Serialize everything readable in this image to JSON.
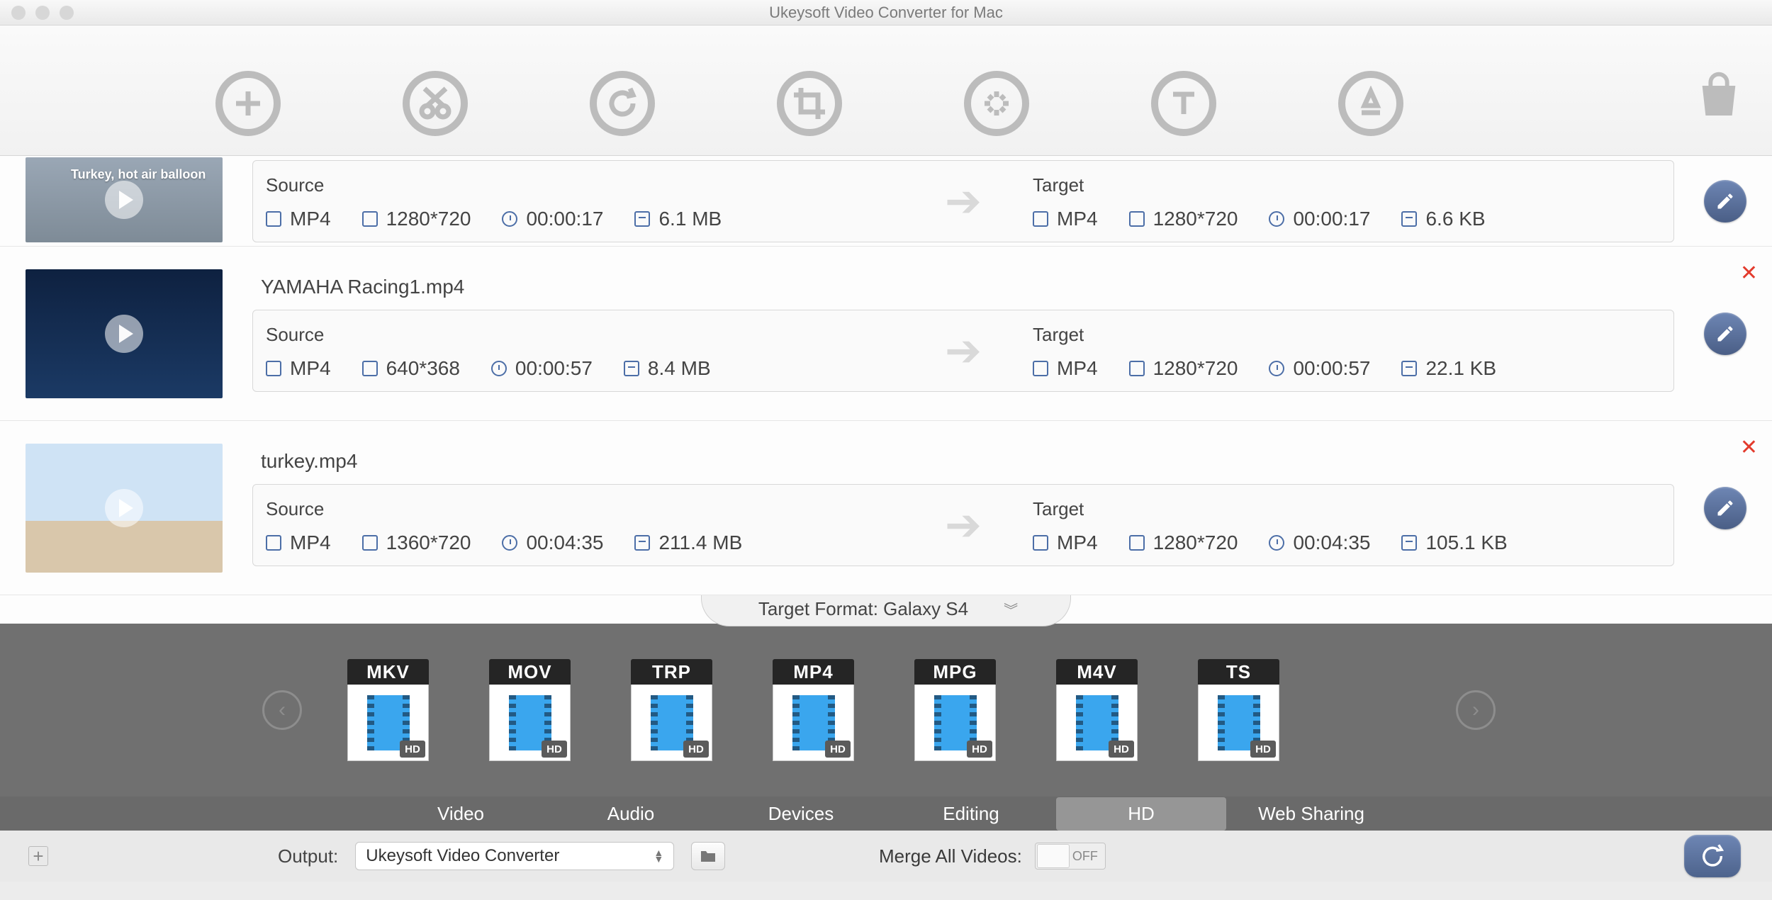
{
  "window": {
    "title": "Ukeysoft Video Converter for Mac"
  },
  "toolbar": {
    "icons": [
      "add",
      "trim",
      "rotate",
      "crop",
      "effects",
      "text",
      "watermark"
    ],
    "store_icon": "shopping-bag"
  },
  "labels": {
    "source": "Source",
    "target": "Target"
  },
  "items": [
    {
      "file": "",
      "thumb_caption": "Turkey, hot air balloon",
      "source": {
        "format": "MP4",
        "resolution": "1280*720",
        "duration": "00:00:17",
        "size": "6.1 MB"
      },
      "target": {
        "format": "MP4",
        "resolution": "1280*720",
        "duration": "00:00:17",
        "size": "6.6 KB"
      }
    },
    {
      "file": "YAMAHA Racing1.mp4",
      "thumb_caption": "",
      "source": {
        "format": "MP4",
        "resolution": "640*368",
        "duration": "00:00:57",
        "size": "8.4 MB"
      },
      "target": {
        "format": "MP4",
        "resolution": "1280*720",
        "duration": "00:00:57",
        "size": "22.1 KB"
      }
    },
    {
      "file": "turkey.mp4",
      "thumb_caption": "",
      "source": {
        "format": "MP4",
        "resolution": "1360*720",
        "duration": "00:04:35",
        "size": "211.4 MB"
      },
      "target": {
        "format": "MP4",
        "resolution": "1280*720",
        "duration": "00:04:35",
        "size": "105.1 KB"
      }
    }
  ],
  "target_format": {
    "label_prefix": "Target Format: ",
    "value": "Galaxy S4"
  },
  "formats": [
    "MKV",
    "MOV",
    "TRP",
    "MP4",
    "MPG",
    "M4V",
    "TS"
  ],
  "format_hd_tag": "HD",
  "categories": [
    "Video",
    "Audio",
    "Devices",
    "Editing",
    "HD",
    "Web Sharing"
  ],
  "category_selected": "HD",
  "footer": {
    "output_label": "Output:",
    "output_value": "Ukeysoft Video Converter",
    "merge_label": "Merge All Videos:",
    "merge_state": "OFF"
  }
}
